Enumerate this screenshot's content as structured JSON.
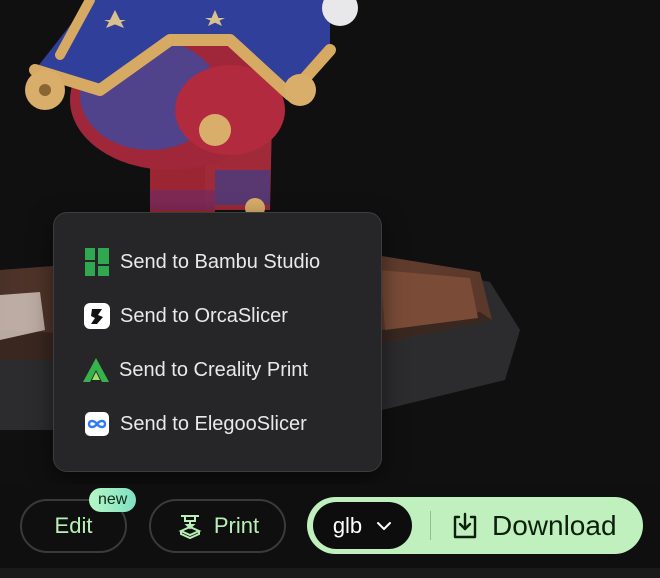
{
  "menu": {
    "items": [
      {
        "label": "Send to Bambu Studio",
        "icon": "bambu-studio-icon"
      },
      {
        "label": "Send to OrcaSlicer",
        "icon": "orcaslicer-icon"
      },
      {
        "label": "Send to Creality Print",
        "icon": "creality-print-icon"
      },
      {
        "label": "Send to ElegooSlicer",
        "icon": "elegooslicer-icon"
      }
    ]
  },
  "toolbar": {
    "edit_label": "Edit",
    "new_badge": "new",
    "print_label": "Print",
    "format_value": "glb",
    "download_label": "Download"
  },
  "colors": {
    "accent": "#bff0bd",
    "menu_bg": "#262628",
    "bambu_green": "#2fa84f",
    "creality_green": "#37b24d",
    "elegoo_blue": "#2f7bf6"
  }
}
